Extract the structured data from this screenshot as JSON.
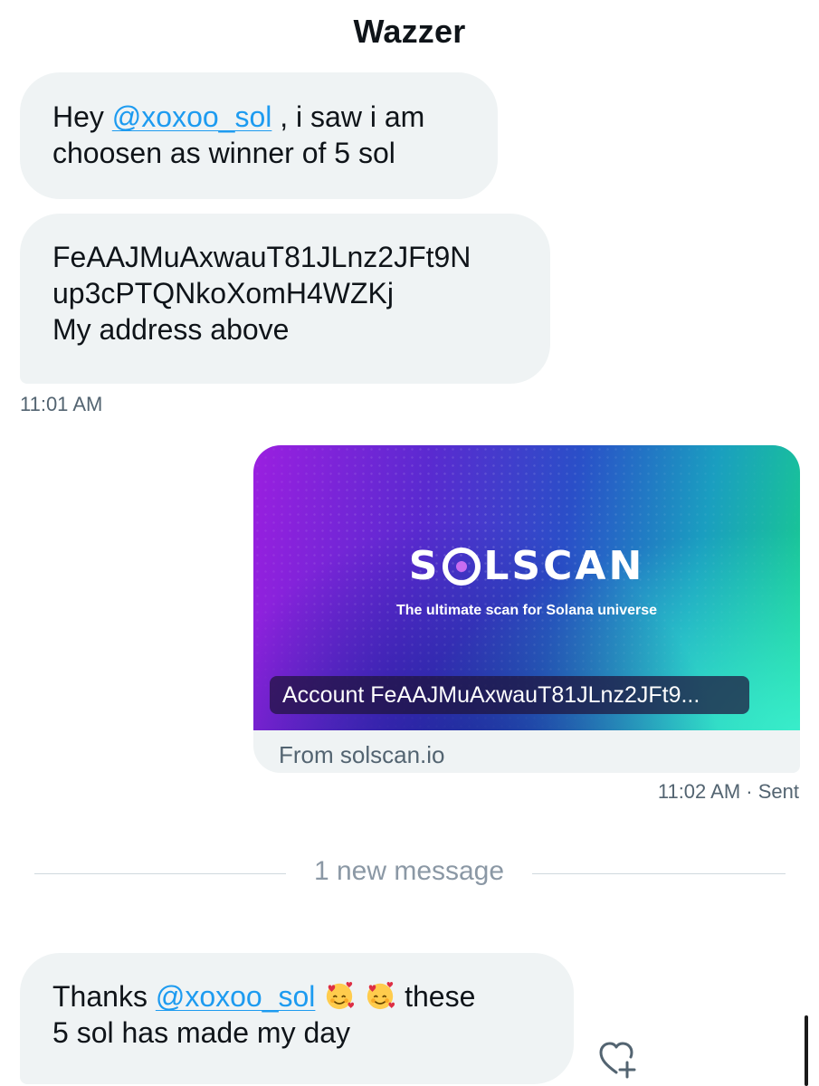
{
  "header": {
    "title": "Wazzer"
  },
  "messages": {
    "m1": {
      "pre": "Hey ",
      "mention": "@xoxoo_sol",
      "line1_post": " , i saw i am",
      "line2": "choosen as winner of 5 sol"
    },
    "m2": {
      "line1": "FeAAJMuAxwauT81JLnz2JFt9N",
      "line2": "up3cPTQNkoXomH4WZKj",
      "line3": "My address above"
    },
    "m2_time": "11:01 AM",
    "card": {
      "logo_pre": "S",
      "logo_post": "LSCAN",
      "tagline": "The ultimate scan for Solana universe",
      "label": "Account FeAAJMuAxwauT81JLnz2JFt9...",
      "source": "From solscan.io"
    },
    "card_time": "11:02 AM",
    "card_status": " · Sent",
    "divider_text": "1 new message",
    "m3": {
      "pre": "Thanks ",
      "mention": "@xoxoo_sol",
      "line1_post": " these",
      "line2": "5 sol has made my day"
    }
  },
  "icons": {
    "emoji": "smiling-face-with-hearts-icon",
    "reaction": "heart-add-icon"
  },
  "colors": {
    "bubble_bg": "#eff3f4",
    "mention": "#1d9bf0",
    "secondary_text": "#536471"
  }
}
